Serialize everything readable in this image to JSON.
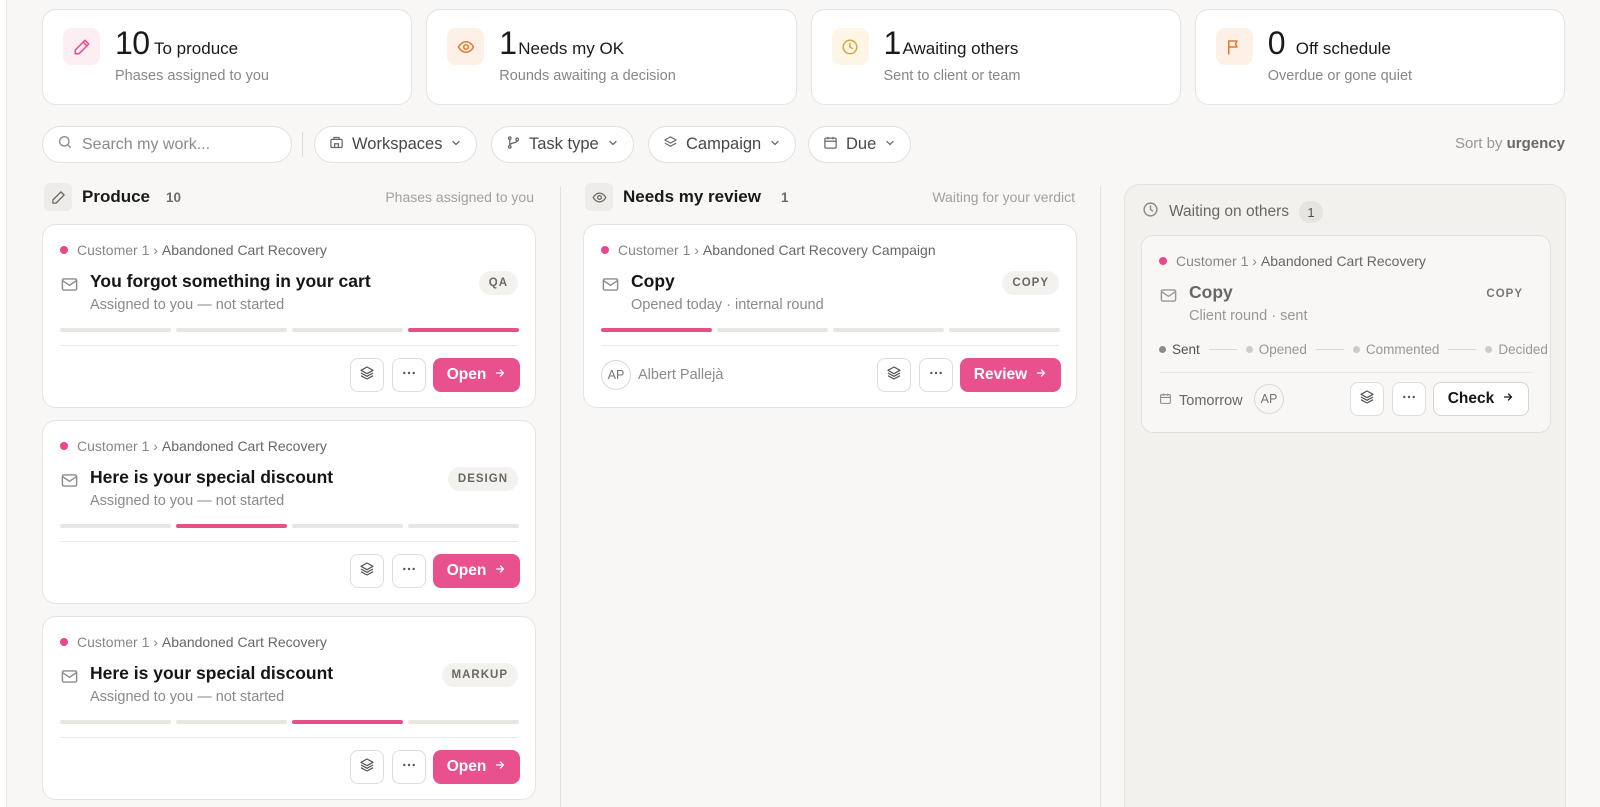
{
  "stats": [
    {
      "number": "10",
      "title": "To produce",
      "subtitle": "Phases assigned to you",
      "icon": "pencil-icon",
      "color": "#e8488a",
      "bg": "#fdeef4"
    },
    {
      "number": "1",
      "title": "Needs my OK",
      "subtitle": "Rounds awaiting a decision",
      "icon": "eye-icon",
      "color": "#e2782e",
      "bg": "#fdf0e6"
    },
    {
      "number": "1",
      "title": "Awaiting others",
      "subtitle": "Sent to client or team",
      "icon": "clock-icon",
      "color": "#d9a43a",
      "bg": "#fdf6e6"
    },
    {
      "number": "0",
      "title": "Off schedule",
      "subtitle": "Overdue or gone quiet",
      "icon": "flag-icon",
      "color": "#e2782e",
      "bg": "#fdf0e6"
    }
  ],
  "toolbar": {
    "search_placeholder": "Search my work...",
    "filters": [
      "Workspaces",
      "Task type",
      "Campaign",
      "Due"
    ],
    "sort_prefix": "Sort by",
    "sort_value": "urgency"
  },
  "columns": {
    "produce": {
      "title": "Produce",
      "count": "10",
      "hint": "Phases assigned to you"
    },
    "review": {
      "title": "Needs my review",
      "count": "1",
      "hint": "Waiting for your verdict"
    },
    "waiting": {
      "title": "Waiting on others",
      "count": "1"
    }
  },
  "produce_cards": [
    {
      "customer": "Customer 1",
      "campaign": "Abandoned Cart Recovery",
      "title": "You forgot something in your cart",
      "subtitle": "Assigned to you — not started",
      "tag": "QA",
      "progress": [
        0,
        0,
        0,
        1
      ],
      "action": "Open"
    },
    {
      "customer": "Customer 1",
      "campaign": "Abandoned Cart Recovery",
      "title": "Here is your special discount",
      "subtitle": "Assigned to you — not started",
      "tag": "DESIGN",
      "progress": [
        0,
        1,
        0,
        0
      ],
      "action": "Open"
    },
    {
      "customer": "Customer 1",
      "campaign": "Abandoned Cart Recovery",
      "title": "Here is your special discount",
      "subtitle": "Assigned to you — not started",
      "tag": "MARKUP",
      "progress": [
        0,
        0,
        1,
        0
      ],
      "action": "Open"
    }
  ],
  "review_card": {
    "customer": "Customer 1",
    "campaign": "Abandoned Cart Recovery Campaign",
    "title": "Copy",
    "subtitle": "Opened today · internal round",
    "tag": "COPY",
    "progress": [
      1,
      0,
      0,
      0
    ],
    "avatar": "AP",
    "assignee": "Albert Pallejà",
    "action": "Review"
  },
  "waiting_card": {
    "customer": "Customer 1",
    "campaign": "Abandoned Cart Recovery",
    "title": "Copy",
    "subtitle": "Client round · sent",
    "tag": "COPY",
    "stages": [
      "Sent",
      "Opened",
      "Commented",
      "Decided"
    ],
    "stages_done": 1,
    "due": "Tomorrow",
    "avatar": "AP",
    "action": "Check"
  },
  "colors": {
    "accent": "#e8518d",
    "background": "#f8f7f5"
  }
}
